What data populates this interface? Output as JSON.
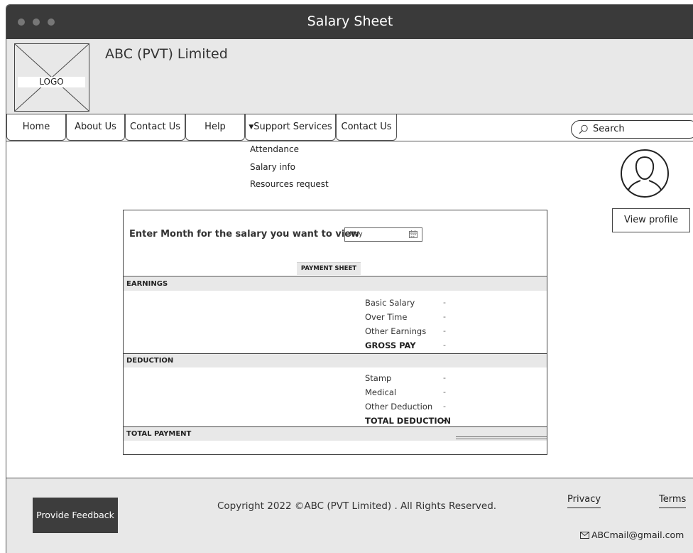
{
  "window": {
    "title": "Salary Sheet"
  },
  "header": {
    "logo_label": "LOGO",
    "company": "ABC (PVT) Limited"
  },
  "nav": {
    "tabs": [
      "Home",
      "About Us",
      "Contact Us",
      "Help",
      "Support Services",
      "Contact Us"
    ],
    "support_services_open": true,
    "search_placeholder": "Search"
  },
  "dropdown": {
    "items": [
      "Attendance",
      "Salary info",
      "Resources request"
    ]
  },
  "profile": {
    "button": "View profile"
  },
  "salary": {
    "prompt": "Enter Month for the salary you want to view",
    "month_value": "May",
    "sheet_label": "PAYMENT SHEET",
    "earnings_heading": "EARNINGS",
    "earnings": [
      {
        "label": "Basic Salary",
        "value": "-"
      },
      {
        "label": "Over Time",
        "value": "-"
      },
      {
        "label": "Other Earnings",
        "value": "-"
      },
      {
        "label": "GROSS PAY",
        "value": "-"
      }
    ],
    "deduction_heading": "DEDUCTION",
    "deductions": [
      {
        "label": "Stamp",
        "value": "-"
      },
      {
        "label": "Medical",
        "value": "-"
      },
      {
        "label": "Other Deduction",
        "value": "-"
      },
      {
        "label": "TOTAL DEDUCTION",
        "value": "-"
      }
    ],
    "total_heading": "TOTAL PAYMENT"
  },
  "footer": {
    "feedback_button": "Provide Feedback",
    "copyright": "Copyright 2022 ©ABC (PVT Limited) . All Rights Reserved.",
    "privacy": "Privacy",
    "terms": "Terms",
    "email": "ABCmail@gmail.com"
  }
}
